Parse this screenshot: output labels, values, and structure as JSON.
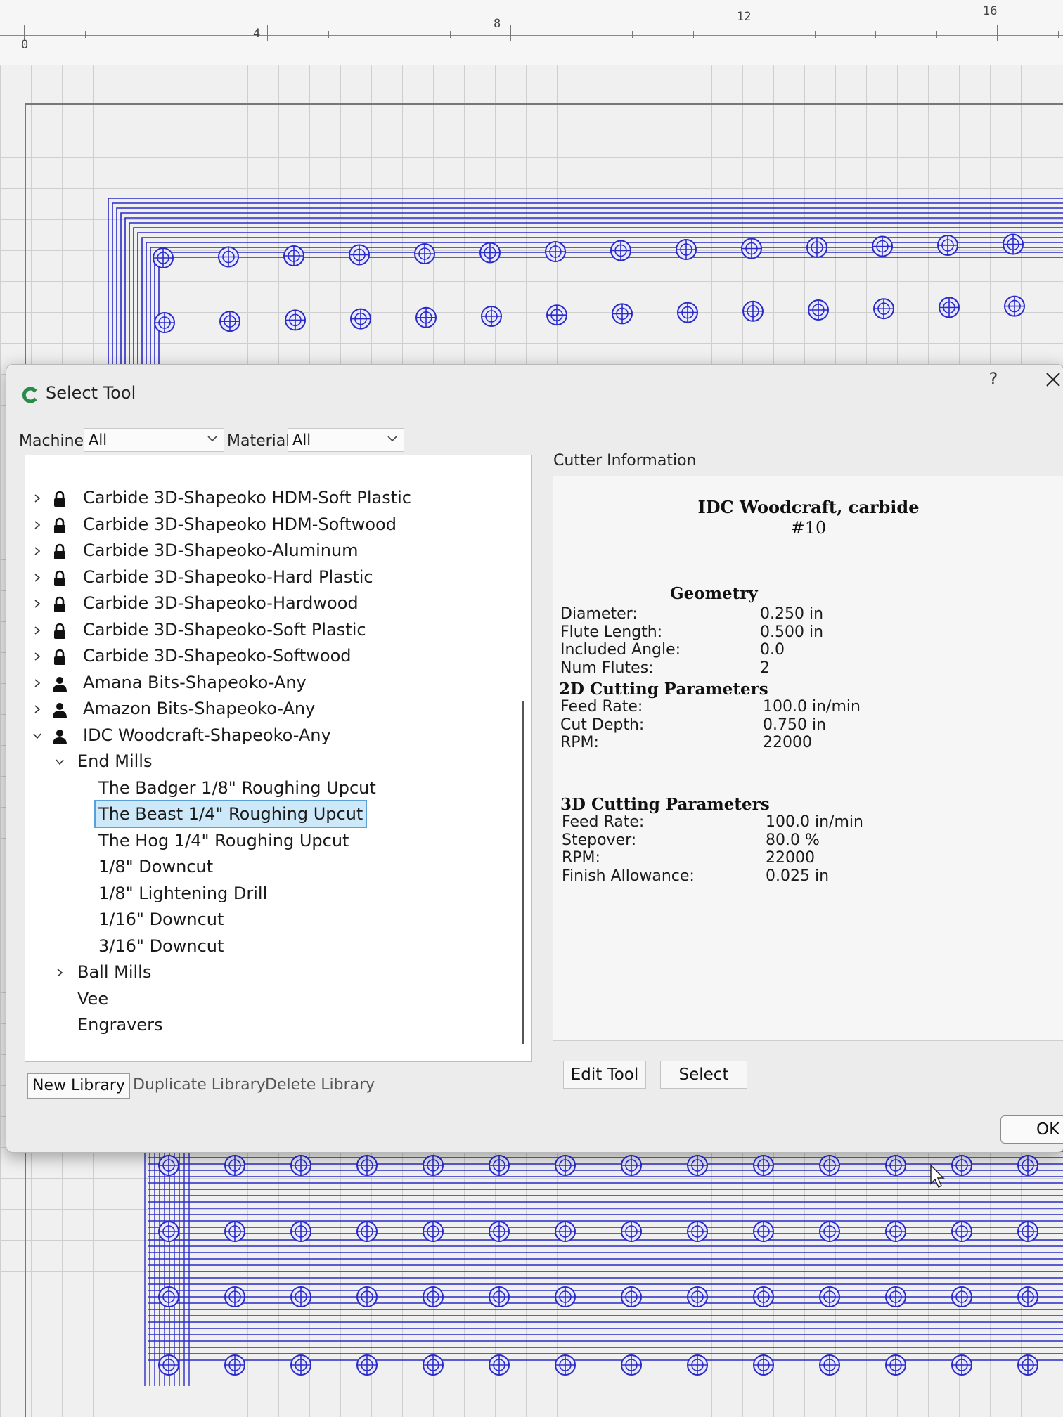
{
  "ruler": {
    "labels": [
      "0",
      "4",
      "8",
      "12",
      "16"
    ]
  },
  "dialog": {
    "title": "Select Tool",
    "help_label": "?",
    "filters": {
      "machine_label": "Machine",
      "machine_value": "All",
      "material_label": "Material",
      "material_value": "All"
    },
    "tree": [
      {
        "label": "Carbide 3D-Shapeoko HDM-Soft Plastic",
        "icon": "lock-icon",
        "expanded": false
      },
      {
        "label": "Carbide 3D-Shapeoko HDM-Softwood",
        "icon": "lock-icon",
        "expanded": false
      },
      {
        "label": "Carbide 3D-Shapeoko-Aluminum",
        "icon": "lock-icon",
        "expanded": false
      },
      {
        "label": "Carbide 3D-Shapeoko-Hard Plastic",
        "icon": "lock-icon",
        "expanded": false
      },
      {
        "label": "Carbide 3D-Shapeoko-Hardwood",
        "icon": "lock-icon",
        "expanded": false
      },
      {
        "label": "Carbide 3D-Shapeoko-Soft Plastic",
        "icon": "lock-icon",
        "expanded": false
      },
      {
        "label": "Carbide 3D-Shapeoko-Softwood",
        "icon": "lock-icon",
        "expanded": false
      },
      {
        "label": "Amana Bits-Shapeoko-Any",
        "icon": "user-icon",
        "expanded": false
      },
      {
        "label": "Amazon Bits-Shapeoko-Any",
        "icon": "user-icon",
        "expanded": false
      },
      {
        "label": "IDC Woodcraft-Shapeoko-Any",
        "icon": "user-icon",
        "expanded": true
      },
      {
        "label": "End Mills",
        "expanded": true
      },
      {
        "label": "The Badger 1/8\" Roughing Upcut"
      },
      {
        "label": "The Beast 1/4\" Roughing Upcut",
        "selected": true
      },
      {
        "label": "The Hog 1/4\" Roughing Upcut"
      },
      {
        "label": "1/8\" Downcut"
      },
      {
        "label": "1/8\" Lightening Drill"
      },
      {
        "label": "1/16\" Downcut"
      },
      {
        "label": "3/16\" Downcut"
      },
      {
        "label": "Ball Mills",
        "expanded": false
      },
      {
        "label": "Vee"
      },
      {
        "label": "Engravers"
      }
    ],
    "library_buttons": {
      "new": "New Library",
      "duplicate": "Duplicate Library",
      "delete": "Delete Library"
    },
    "cutter_info": {
      "heading": "Cutter Information",
      "tool_name": "IDC Woodcraft, carbide",
      "tool_number": "#10",
      "geometry": {
        "title": "Geometry",
        "rows": [
          {
            "label": "Diameter:",
            "value": "0.250 in"
          },
          {
            "label": "Flute Length:",
            "value": "0.500 in"
          },
          {
            "label": "Included Angle:",
            "value": "0.0"
          },
          {
            "label": "Num Flutes:",
            "value": "2"
          }
        ]
      },
      "cutting_2d": {
        "title": "2D Cutting Parameters",
        "rows": [
          {
            "label": "Feed Rate:",
            "value": "100.0 in/min"
          },
          {
            "label": "Cut Depth:",
            "value": "0.750 in"
          },
          {
            "label": "RPM:",
            "value": "22000"
          }
        ]
      },
      "cutting_3d": {
        "title": "3D Cutting Parameters",
        "rows": [
          {
            "label": "Feed Rate:",
            "value": "100.0 in/min"
          },
          {
            "label": "Stepover:",
            "value": "80.0 %"
          },
          {
            "label": "RPM:",
            "value": "22000"
          },
          {
            "label": "Finish Allowance:",
            "value": "0.025 in"
          }
        ]
      }
    },
    "edit_tool_label": "Edit Tool",
    "select_label": "Select",
    "ok_label": "OK"
  },
  "colors": {
    "toolpath": "#2a2ac8",
    "selection": "#cde8f8",
    "accent": "#2a8a4a"
  }
}
